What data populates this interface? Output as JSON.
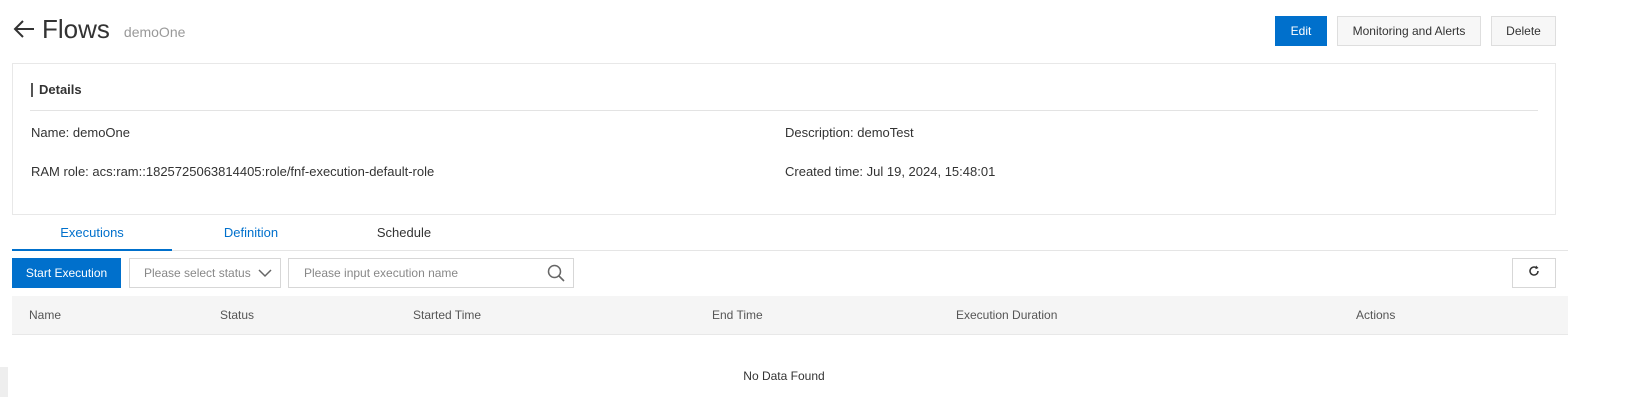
{
  "header": {
    "title": "Flows",
    "subtitle": "demoOne",
    "back_icon": "arrow-left-icon"
  },
  "actions": {
    "edit": "Edit",
    "monitoring": "Monitoring and Alerts",
    "delete": "Delete"
  },
  "details": {
    "heading": "Details",
    "name": "Name: demoOne",
    "description": "Description: demoTest",
    "ram_role": "RAM role: acs:ram::1825725063814405:role/fnf-execution-default-role",
    "created_time": "Created time: Jul 19, 2024, 15:48:01"
  },
  "tabs": [
    {
      "label": "Executions",
      "active": true
    },
    {
      "label": "Definition",
      "active": false
    },
    {
      "label": "Schedule",
      "active": false
    }
  ],
  "toolbar": {
    "start_execution": "Start Execution",
    "status_placeholder": "Please select status",
    "search_placeholder": "Please input execution name",
    "search_icon": "search-icon",
    "refresh_icon": "refresh-icon"
  },
  "table": {
    "columns": [
      "Name",
      "Status",
      "Started Time",
      "End Time",
      "Execution Duration",
      "Actions"
    ],
    "rows": [],
    "empty_text": "No Data Found"
  },
  "colors": {
    "primary": "#0070cc",
    "border": "#dedede",
    "header_bg": "#f5f5f5"
  }
}
